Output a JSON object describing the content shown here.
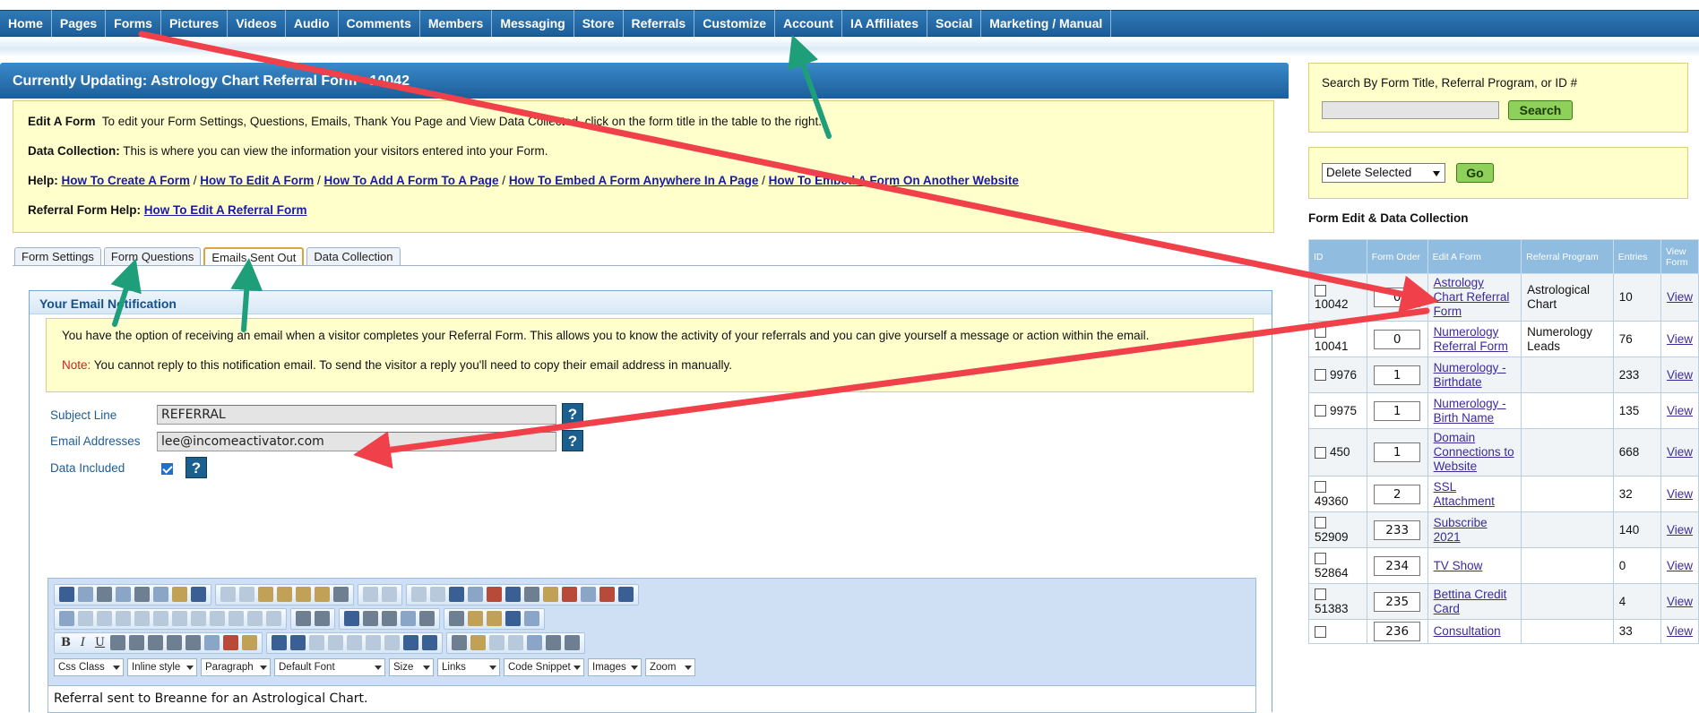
{
  "nav": {
    "items": [
      "Home",
      "Pages",
      "Forms",
      "Pictures",
      "Videos",
      "Audio",
      "Comments",
      "Members",
      "Messaging",
      "Store",
      "Referrals",
      "Customize",
      "Account",
      "IA Affiliates",
      "Social",
      "Marketing / Manual"
    ]
  },
  "main": {
    "header": "Currently Updating: Astrology Chart Referral Form - 10042",
    "info": {
      "edit_label": "Edit A Form",
      "edit_text": "To edit your Form Settings, Questions, Emails, Thank You Page and View Data Collected, click on the form title in the table to the right.",
      "data_label": "Data Collection:",
      "data_text": "This is where you can view the information your visitors entered into your Form.",
      "help_label": "Help:",
      "help_links": [
        "How To Create A Form",
        "How To Edit A Form",
        "How To Add A Form To A Page",
        "How To Embed A Form Anywhere In A Page",
        "How To Embed A Form On Another Website"
      ],
      "ref_label": "Referral Form Help:",
      "ref_link": "How To Edit A Referral Form"
    },
    "tabs": [
      "Form Settings",
      "Form Questions",
      "Emails Sent Out",
      "Data Collection"
    ],
    "active_tab": 2,
    "notify": {
      "title": "Your Email Notification",
      "desc": "You have the option of receiving an email when a visitor completes your Referral Form. This allows you to know the activity of your referrals and you can give yourself a message or action within the email.",
      "note_label": "Note:",
      "note_text": "You cannot reply to this notification email. To send the visitor a reply you'll need to copy their email address in manually."
    },
    "fields": {
      "subject_label": "Subject Line",
      "subject_value": "REFERRAL",
      "email_label": "Email Addresses",
      "email_value": "lee@incomeactivator.com",
      "data_label": "Data Included",
      "data_checked": true,
      "help_glyph": "?"
    },
    "editor": {
      "dropdowns": [
        "Css Class",
        "Inline style",
        "Paragraph",
        "Default Font",
        "Size",
        "Links",
        "Code Snippet",
        "Images",
        "Zoom"
      ],
      "format_glyphs": [
        "B",
        "I",
        "U"
      ],
      "content": "Referral sent to Breanne for an Astrological Chart."
    }
  },
  "sidebar": {
    "search_label": "Search By Form Title, Referral Program, or ID #",
    "search_button": "Search",
    "delete_option": "Delete Selected",
    "go_button": "Go",
    "title": "Form Edit & Data Collection",
    "columns": [
      "ID",
      "Form Order",
      "Edit A Form",
      "Referral Program",
      "Entries",
      "View Form"
    ],
    "rows": [
      {
        "id": "10042",
        "order": "0",
        "form": "Astrology Chart Referral Form",
        "program": "Astrological Chart",
        "entries": "10",
        "view": "View"
      },
      {
        "id": "10041",
        "order": "0",
        "form": "Numerology Referral Form",
        "program": "Numerology Leads",
        "entries": "76",
        "view": "View"
      },
      {
        "id": "9976",
        "order": "1",
        "form": "Numerology - Birthdate",
        "program": "",
        "entries": "233",
        "view": "View"
      },
      {
        "id": "9975",
        "order": "1",
        "form": "Numerology - Birth Name",
        "program": "",
        "entries": "135",
        "view": "View"
      },
      {
        "id": "450",
        "order": "1",
        "form": "Domain Connections to Website",
        "program": "",
        "entries": "668",
        "view": "View"
      },
      {
        "id": "49360",
        "order": "2",
        "form": "SSL Attachment",
        "program": "",
        "entries": "32",
        "view": "View"
      },
      {
        "id": "52909",
        "order": "233",
        "form": "Subscribe 2021",
        "program": "",
        "entries": "140",
        "view": "View"
      },
      {
        "id": "52864",
        "order": "234",
        "form": "TV Show",
        "program": "",
        "entries": "0",
        "view": "View"
      },
      {
        "id": "51383",
        "order": "235",
        "form": "Bettina Credit Card",
        "program": "",
        "entries": "4",
        "view": "View"
      },
      {
        "id": "",
        "order": "236",
        "form": "Consultation",
        "program": "",
        "entries": "33",
        "view": "View"
      }
    ]
  },
  "colors": {
    "nav_bg": "#1c5e99",
    "info_bg": "#ffffcc",
    "green_button": "#8ed05a",
    "arrow_red": "#f0404a",
    "arrow_green": "#1f9e7a"
  }
}
